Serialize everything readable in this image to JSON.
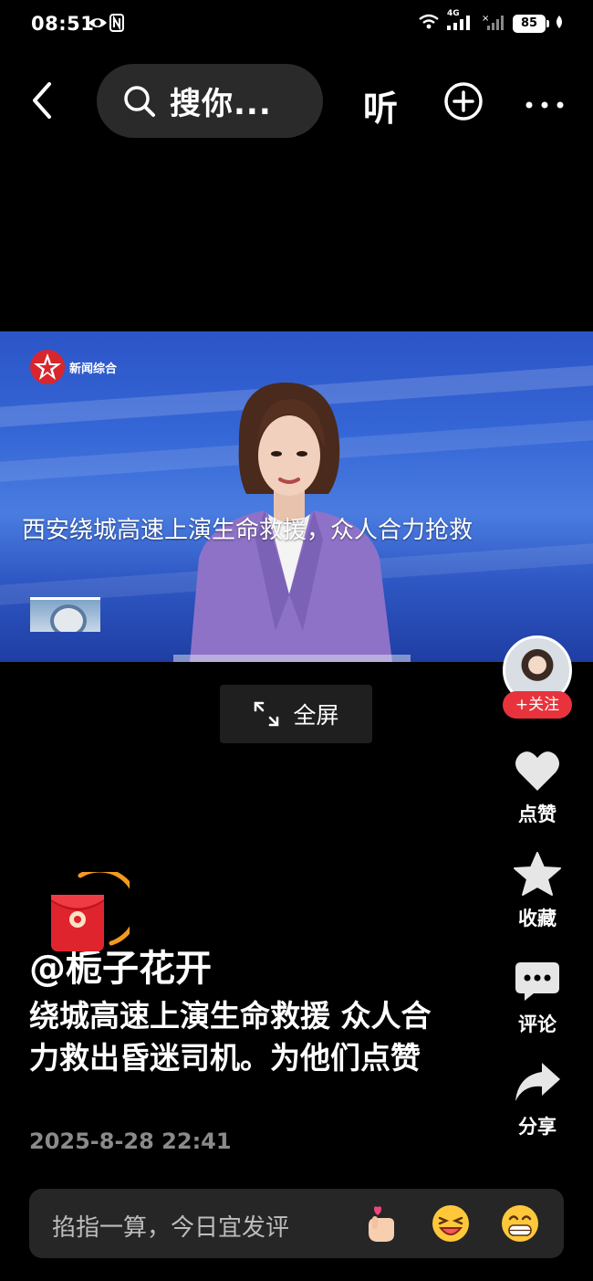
{
  "status_bar": {
    "time": "08:51",
    "network": "4G",
    "battery": "85"
  },
  "top_bar": {
    "search_text": "搜你...",
    "listen_label": "听"
  },
  "video": {
    "channel_name": "新闻综合",
    "headline": "西安绕城高速上演生命救援，众人合力抢救",
    "fullscreen_label": "全屏"
  },
  "actions": {
    "follow": "+关注",
    "like": "点赞",
    "favorite": "收藏",
    "comment": "评论",
    "share": "分享"
  },
  "post": {
    "author": "@栀子花开",
    "caption": "绕城高速上演生命救援  众人合力救出昏迷司机。为他们点赞",
    "timestamp": "2025-8-28 22:41"
  },
  "comment_bar": {
    "placeholder": "掐指一算，今日宜发评"
  },
  "colors": {
    "accent_red": "#e8333d",
    "timer_ring": "#f39a1e"
  }
}
